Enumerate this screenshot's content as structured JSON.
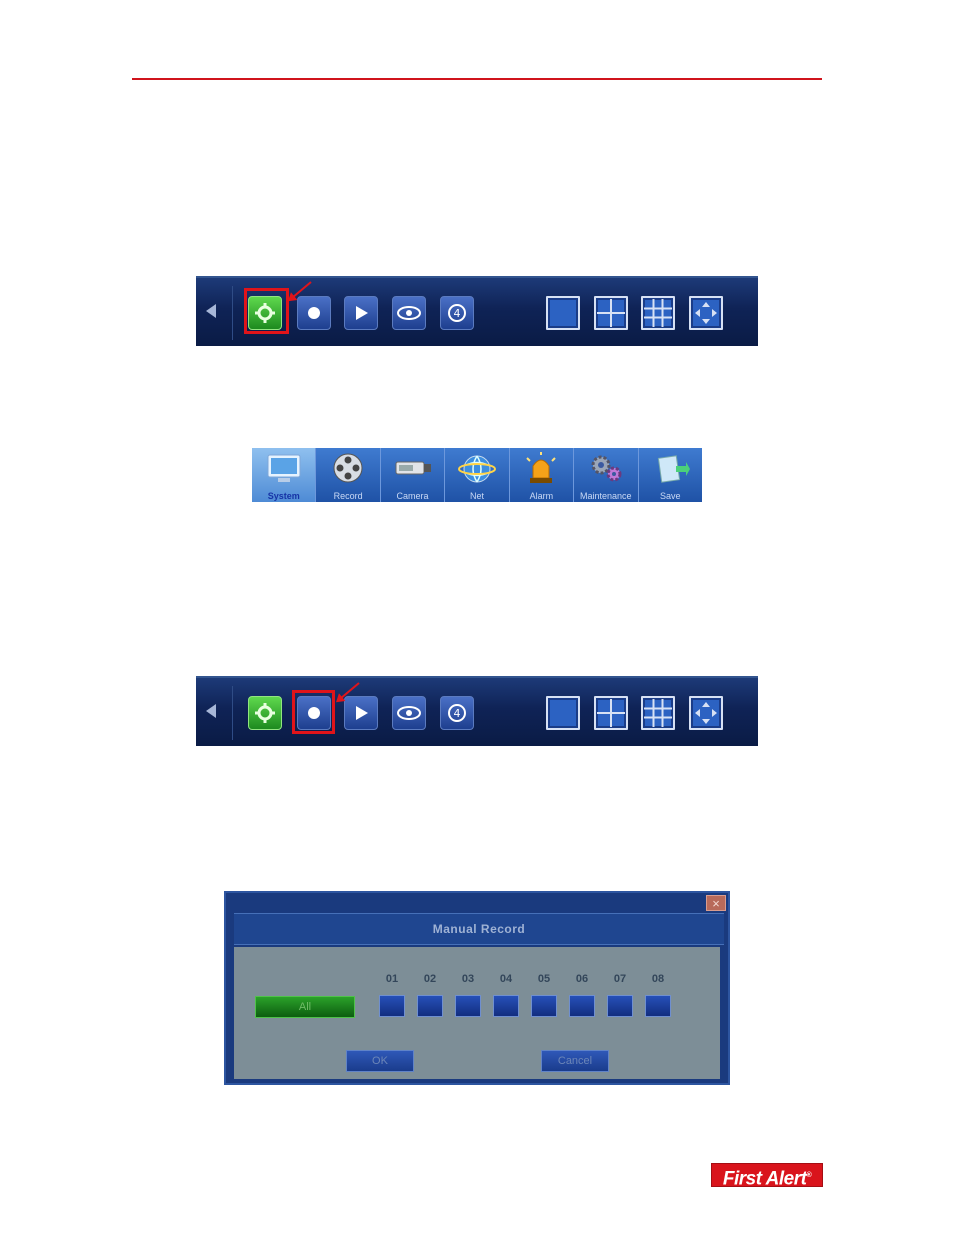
{
  "toolbar": {
    "buttons": [
      "setup",
      "record",
      "playback",
      "view",
      "quad-icon"
    ],
    "views": [
      "single",
      "quad",
      "nine",
      "fullscreen"
    ]
  },
  "menu": {
    "items": [
      "System",
      "Record",
      "Camera",
      "Net",
      "Alarm",
      "Maintenance",
      "Save"
    ]
  },
  "dialog": {
    "title": "Manual Record",
    "close": "×",
    "all_label": "All",
    "channels": [
      "01",
      "02",
      "03",
      "04",
      "05",
      "06",
      "07",
      "08"
    ],
    "ok_label": "OK",
    "cancel_label": "Cancel"
  },
  "logo": {
    "text": "First Alert",
    "mark": "®"
  },
  "colors": {
    "accent_red": "#d0141c",
    "toolbar_blue": "#0f2356",
    "menu_blue": "#1f52a6",
    "green": "#1d8a1f"
  }
}
